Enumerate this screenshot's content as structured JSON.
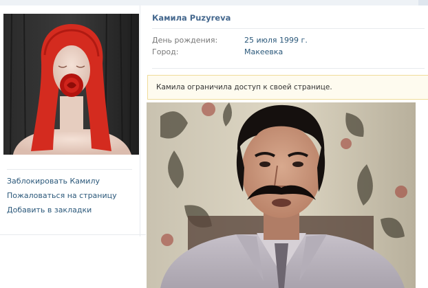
{
  "profile": {
    "name": "Камила Puzyreva",
    "info": [
      {
        "label": "День рождения:",
        "value": "25 июля 1999 г."
      },
      {
        "label": "Город:",
        "value": "Макеевка"
      }
    ],
    "notice": "Камила ограничила доступ к своей странице."
  },
  "actions": [
    {
      "label": "Заблокировать Камилу"
    },
    {
      "label": "Пожаловаться на страницу"
    },
    {
      "label": "Добавить в закладки"
    }
  ],
  "colors": {
    "link": "#2b587a",
    "name": "#45688e",
    "label": "#777777",
    "notice_bg": "#fefbef",
    "notice_border": "#f0dc9a"
  }
}
